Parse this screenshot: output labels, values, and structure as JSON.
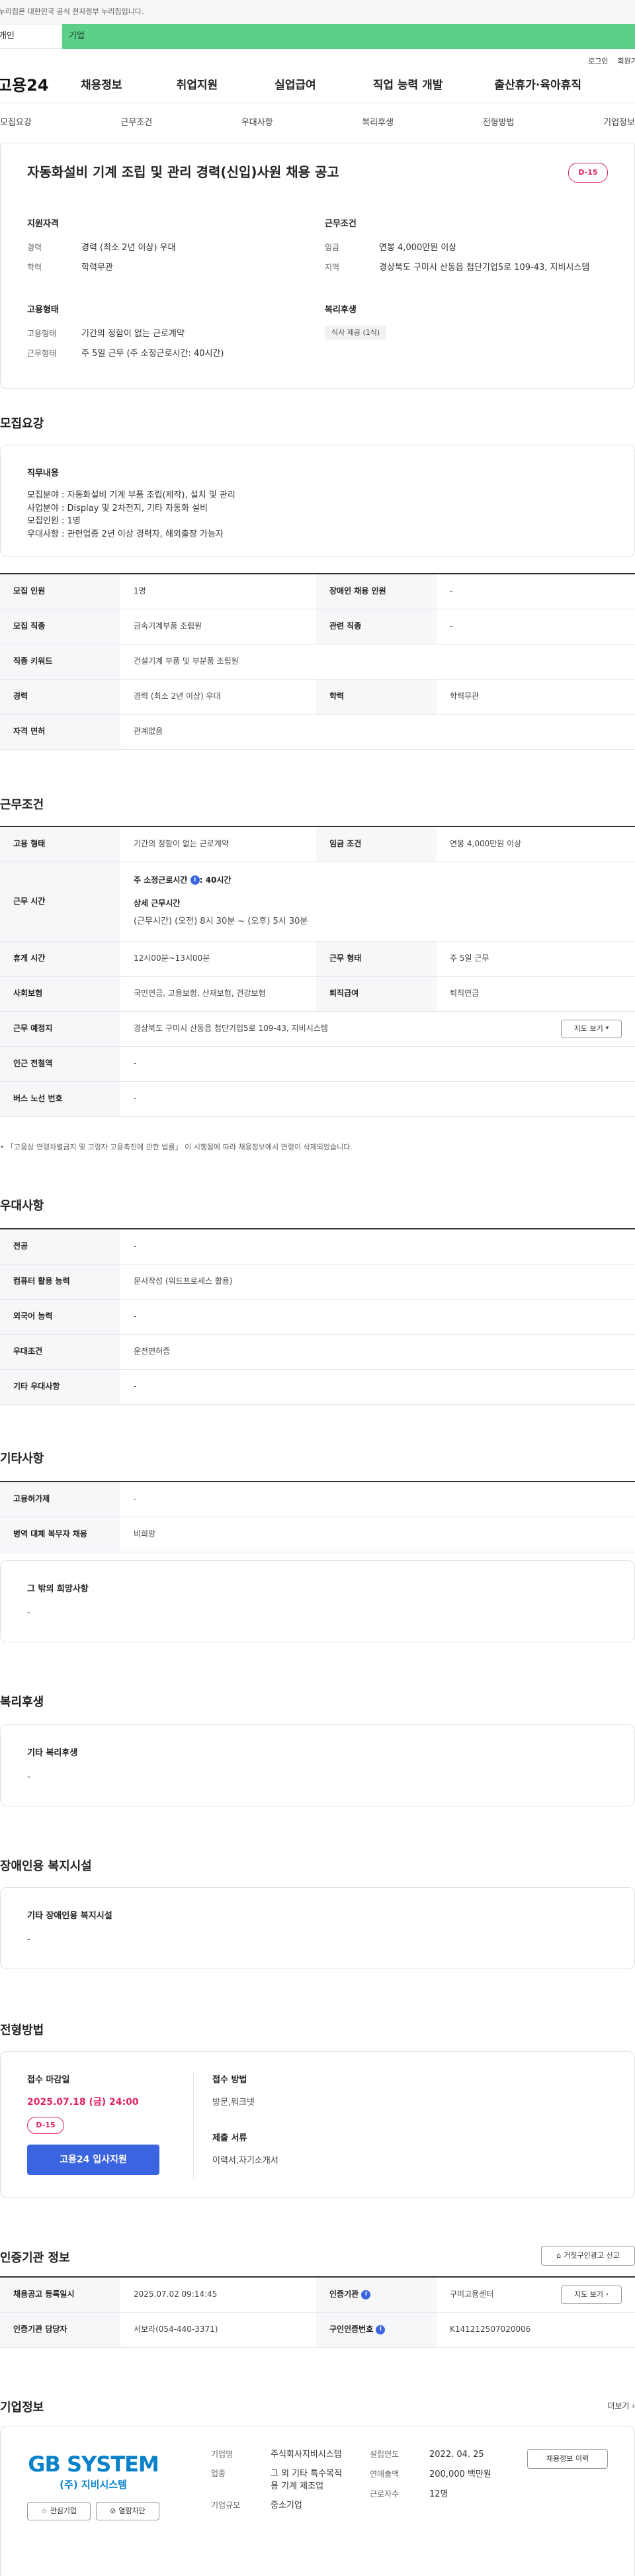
{
  "gov_banner": "이 누리집은 대한민국 공식 전자정부 누리집입니다.",
  "user_tabs": [
    "개인",
    "기업"
  ],
  "top_links": [
    "로그인",
    "회원가입"
  ],
  "gnb": {
    "logo": "고용24",
    "menu": [
      "채용정보",
      "취업지원",
      "실업급여",
      "직업 능력 개발",
      "출산휴가·육아휴직"
    ]
  },
  "subnav": [
    "모집요강",
    "근무조건",
    "우대사항",
    "복리후생",
    "전형방법",
    "기업정보"
  ],
  "header": {
    "title": "자동화설비 기계 조립 및 관리 경력(신입)사원 채용 공고",
    "dday": "D-15"
  },
  "summary": {
    "qual_title": "지원자격",
    "qual": [
      {
        "label": "경력",
        "value": "경력 (최소 2년 이상) 우대"
      },
      {
        "label": "학력",
        "value": "학력무관"
      }
    ],
    "cond_title": "근무조건",
    "cond": [
      {
        "label": "임금",
        "value": "연봉 4,000만원 이상"
      },
      {
        "label": "지역",
        "value": "경상북도 구미시 산동읍 첨단기업5로 109-43, 지비시스템"
      }
    ],
    "emp_title": "고용형태",
    "emp": [
      {
        "label": "고용형태",
        "value": "기간의 정함이 없는 근로계약"
      },
      {
        "label": "근무형태",
        "value": "주 5일 근무 (주 소정근로시간: 40시간)"
      }
    ],
    "welfare_title": "복리후생",
    "welfare_tag": "식사 제공 (1식)"
  },
  "recruit": {
    "title": "모집요강",
    "duty_title": "직무내용",
    "duty_lines": [
      "모집분야 : 자동화설비 기계 부품 조립(제작), 설치 및 관리",
      "사업분야 : Display 및 2차전지, 기타 자동화 설비",
      "모집인원 : 1명",
      "우대사항 : 관련업종 2년 이상 경력자, 해외출장 가능자"
    ],
    "rows": [
      [
        {
          "h": "모집 인원",
          "v": "1명"
        },
        {
          "h": "장애인 채용 인원",
          "v": "-"
        }
      ],
      [
        {
          "h": "모집 직종",
          "v": "금속기계부품 조립원"
        },
        {
          "h": "관련 직종",
          "v": "-"
        }
      ],
      [
        {
          "h": "직종 키워드",
          "v": "건설기계 부품 및 부분품 조립원"
        }
      ],
      [
        {
          "h": "경력",
          "v": "경력 (최소 2년 이상) 우대"
        },
        {
          "h": "학력",
          "v": "학력무관"
        }
      ],
      [
        {
          "h": "자격 면허",
          "v": "관계없음"
        }
      ]
    ]
  },
  "work": {
    "title": "근무조건",
    "emp_type_h": "고용 형태",
    "emp_type_v": "기간의 정함이 없는 근로계약",
    "wage_h": "임금 조건",
    "wage_v": "연봉 4,000만원 이상",
    "time_h": "근무 시간",
    "weekly_label": "주 소정근로시간",
    "weekly_value": ": 40시간",
    "detail_label": "상세 근무시간",
    "detail_value": "(근무시간) (오전) 8시 30분 ~ (오후) 5시 30분",
    "break_h": "휴게 시간",
    "break_v": "12시00분~13시00분",
    "form_h": "근무 형태",
    "form_v": "주 5일 근무",
    "ins_h": "사회보험",
    "ins_v": "국민연금, 고용보험, 산재보험, 건강보험",
    "sev_h": "퇴직급여",
    "sev_v": "퇴직연금",
    "place_h": "근무 예정지",
    "place_v": "경상북도 구미시 산동읍 첨단기업5로 109-43, 지비시스템",
    "map_btn": "지도 보기",
    "subway_h": "인근 전철역",
    "subway_v": "-",
    "bus_h": "버스 노선 번호",
    "bus_v": "-",
    "note": "「고용상 연령차별금지 및 고령자 고용촉진에 관한 법률」 이 시행됨에 따라 채용정보에서 연령이 삭제되었습니다."
  },
  "pref": {
    "title": "우대사항",
    "rows": [
      {
        "h": "전공",
        "v": "-"
      },
      {
        "h": "컴퓨터 활용 능력",
        "v": "문서작성 (워드프로세스 활용)"
      },
      {
        "h": "외국어 능력",
        "v": "-"
      },
      {
        "h": "우대조건",
        "v": "운전면허증"
      },
      {
        "h": "기타 우대사항",
        "v": "-"
      }
    ]
  },
  "etc": {
    "title": "기타사항",
    "rows": [
      {
        "h": "고용허가제",
        "v": "-"
      },
      {
        "h": "병역 대체 복무자 채용",
        "v": "비희망"
      }
    ],
    "hope_title": "그 밖의 희망사항",
    "hope_value": "-"
  },
  "welfare": {
    "title": "복리후생",
    "box_title": "기타 복리후생",
    "box_value": "-"
  },
  "disabled": {
    "title": "장애인용 복지시설",
    "box_title": "기타 장애인용 복지시설",
    "box_value": "-"
  },
  "selection": {
    "title": "전형방법",
    "deadline_label": "접수 마감일",
    "deadline": "2025.07.18 (금) 24:00",
    "dday": "D-15",
    "apply_btn": "고용24 입사지원",
    "method_label": "접수 방법",
    "method_value": "방문,워크넷",
    "docs_label": "제출 서류",
    "docs_value": "이력서,자기소개서"
  },
  "agency": {
    "title": "인증기관 정보",
    "report_btn": "거짓구인광고 신고",
    "reg_h": "채용공고 등록일시",
    "reg_v": "2025.07.02 09:14:45",
    "org_h": "인증기관",
    "org_v": "구미고용센터",
    "map_btn": "지도 보기",
    "mgr_h": "인증기관 담당자",
    "mgr_v": "서보라(054-440-3371)",
    "num_h": "구인인증번호",
    "num_v": "K141212507020006"
  },
  "company": {
    "title": "기업정보",
    "more": "더보기",
    "logo_main": "GB SYSTEM",
    "logo_sub": "(주) 지비시스템",
    "fav_btn": "관심기업",
    "block_btn": "열람차단",
    "fields": [
      {
        "label": "기업명",
        "value": "주식회사지비시스템"
      },
      {
        "label": "업종",
        "value": "그 외 기타 특수목적용 기계 제조업"
      },
      {
        "label": "기업규모",
        "value": "중소기업"
      }
    ],
    "fields2": [
      {
        "label": "설립연도",
        "value": "2022. 04. 25"
      },
      {
        "label": "연매출액",
        "value": "200,000 백만원"
      },
      {
        "label": "근로자수",
        "value": "12명"
      }
    ],
    "history_btn": "채용정보 이력"
  },
  "colors": {
    "accent": "#3b64e0",
    "dday": "#e0245e",
    "green": "#5dcf88"
  }
}
